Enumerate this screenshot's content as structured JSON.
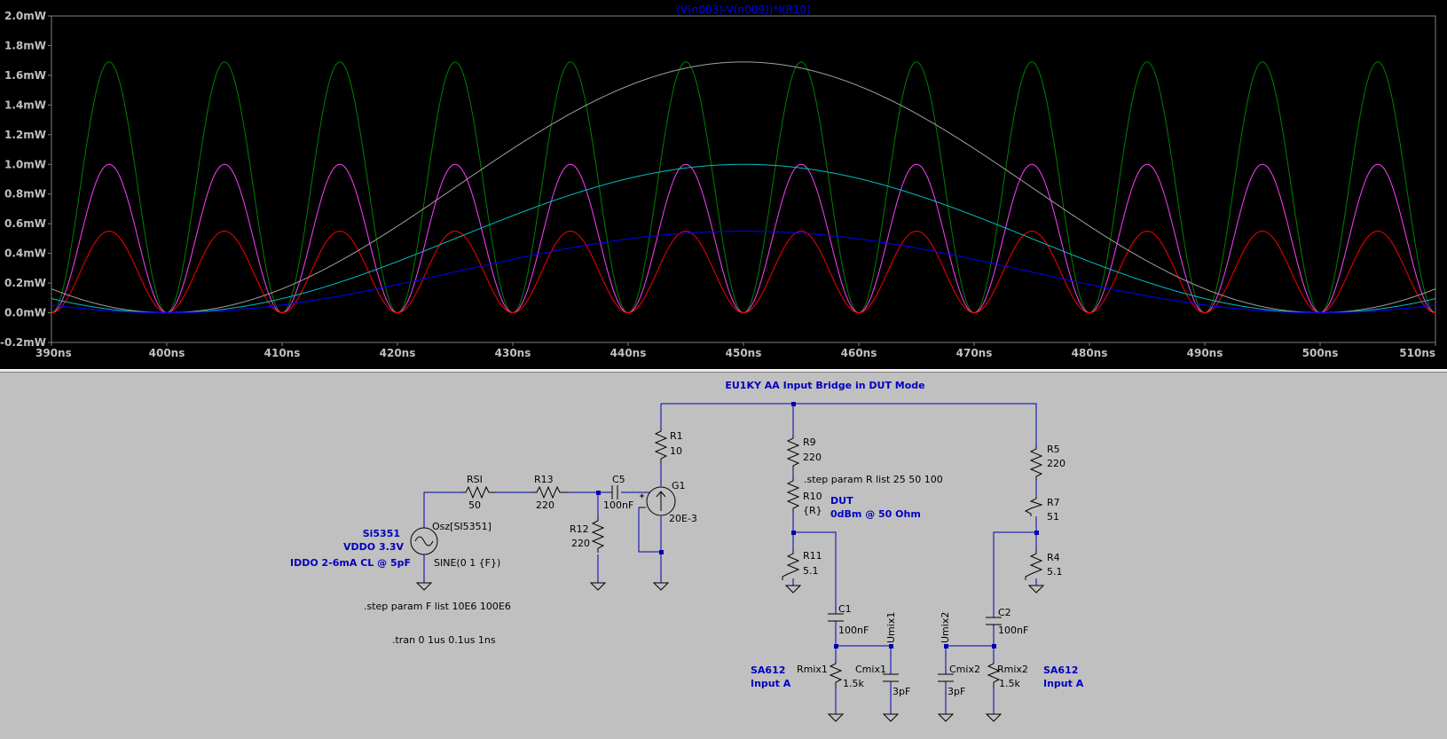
{
  "waveform": {
    "trace_title": "(V(n003)-V(n009))*I(R10)",
    "chart_data": {
      "type": "line",
      "title": "(V(n003)-V(n009))*I(R10)",
      "xlabel": "",
      "ylabel": "",
      "xlim": [
        390,
        510
      ],
      "ylim": [
        -0.2,
        2.0
      ],
      "x_ticks": [
        "390ns",
        "400ns",
        "410ns",
        "420ns",
        "430ns",
        "440ns",
        "450ns",
        "460ns",
        "470ns",
        "480ns",
        "490ns",
        "500ns",
        "510ns"
      ],
      "y_ticks": [
        "-0.2mW",
        "0.0mW",
        "0.2mW",
        "0.4mW",
        "0.6mW",
        "0.8mW",
        "1.0mW",
        "1.2mW",
        "1.4mW",
        "1.6mW",
        "1.8mW",
        "2.0mW"
      ],
      "grid": false,
      "series": [
        {
          "color": "#008000",
          "frequency_hz": 100000000,
          "peak_mw": 1.69
        },
        {
          "color": "#ff40ff",
          "frequency_hz": 100000000,
          "peak_mw": 1.0
        },
        {
          "color": "#ff0000",
          "frequency_hz": 100000000,
          "peak_mw": 0.55
        },
        {
          "color": "#a0a0a0",
          "frequency_hz": 10000000,
          "peak_mw": 1.69
        },
        {
          "color": "#00c0c0",
          "frequency_hz": 10000000,
          "peak_mw": 1.0
        },
        {
          "color": "#0000ff",
          "frequency_hz": 10000000,
          "peak_mw": 0.55
        }
      ]
    }
  },
  "schematic": {
    "title": "EU1KY AA Input Bridge in DUT Mode",
    "directives": {
      "step_r": ".step param R list 25 50 100",
      "step_f": ".step param F list 10E6 100E6",
      "tran": ".tran 0 1us 0.1us 1ns"
    },
    "source": {
      "name": "Osz[SI5351]",
      "value": "SINE(0 1 {F})",
      "label1": "Si5351",
      "label2": "VDDO 3.3V",
      "label3": "IDDO 2-6mA CL @ 5pF"
    },
    "components": {
      "rsi": {
        "name": "RSI",
        "value": "50"
      },
      "r13": {
        "name": "R13",
        "value": "220"
      },
      "c5": {
        "name": "C5",
        "value": "100nF"
      },
      "g1": {
        "name": "G1",
        "value": "20E-3"
      },
      "r12": {
        "name": "R12",
        "value": "220"
      },
      "r1": {
        "name": "R1",
        "value": "10"
      },
      "r9": {
        "name": "R9",
        "value": "220"
      },
      "r10": {
        "name": "R10",
        "value": "{R}"
      },
      "r11": {
        "name": "R11",
        "value": "5.1"
      },
      "r5": {
        "name": "R5",
        "value": "220"
      },
      "r7": {
        "name": "R7",
        "value": "51"
      },
      "r4": {
        "name": "R4",
        "value": "5.1"
      },
      "c1": {
        "name": "C1",
        "value": "100nF"
      },
      "c2": {
        "name": "C2",
        "value": "100nF"
      },
      "rmix1": {
        "name": "Rmix1",
        "value": "1.5k"
      },
      "rmix2": {
        "name": "Rmix2",
        "value": "1.5k"
      },
      "cmix1": {
        "name": "Cmix1",
        "value": "3pF"
      },
      "cmix2": {
        "name": "Cmix2",
        "value": "3pF"
      }
    },
    "labels": {
      "dut1": "DUT",
      "dut2": "0dBm @ 50 Ohm",
      "sa612_left1": "SA612",
      "sa612_left2": "Input A",
      "sa612_right1": "SA612",
      "sa612_right2": "Input A",
      "umix1": "Umix1",
      "umix2": "Umix2"
    },
    "colors": {
      "wire": "#0000b0",
      "component": "#000000",
      "annotation": "#0000c0"
    }
  }
}
